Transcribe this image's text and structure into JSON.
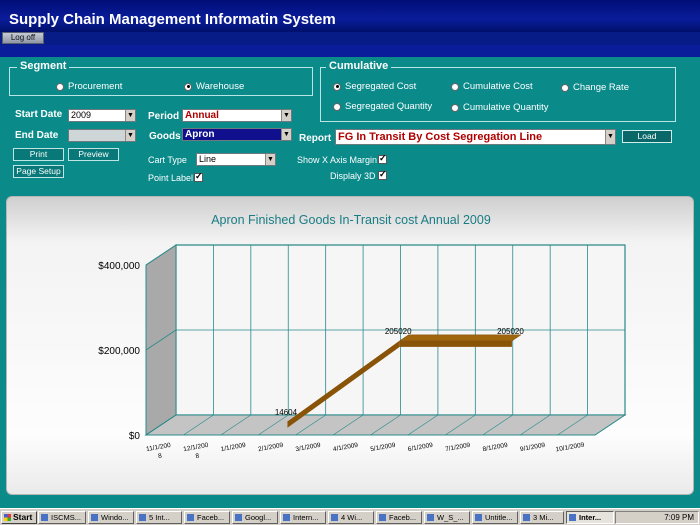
{
  "app": {
    "title": "Supply Chain Management Informatin System",
    "logoff": "Log off"
  },
  "segment": {
    "legend": "Segment",
    "options": [
      "Procurement",
      "Warehouse"
    ],
    "selected": 1
  },
  "cumulative": {
    "legend": "Cumulative",
    "options": [
      "Segregated Cost",
      "Cumulative Cost",
      "Change Rate",
      "Segregated Quantity",
      "Cumulative Quantity"
    ],
    "selected": 0
  },
  "form": {
    "start_date_label": "Start Date",
    "start_date": "2009",
    "end_date_label": "End Date",
    "end_date": "",
    "period_label": "Period",
    "period": "Annual",
    "goods_label": "Goods",
    "goods": "Apron",
    "report_label": "Report",
    "report": "FG In Transit By Cost Segregation Line",
    "load": "Load",
    "print": "Print",
    "preview": "Preview",
    "page_setup": "Page Setup",
    "cart_type_label": "Cart Type",
    "cart_type": "Line",
    "point_label": "Point Label",
    "show_x_margin": "Show X Axis Margin",
    "display_3d": "Displaly 3D"
  },
  "chart_data": {
    "type": "line",
    "title": "Apron Finished Goods In-Transit cost Annual 2009",
    "categories": [
      "11/1/2008",
      "12/1/2008",
      "1/1/2009",
      "2/1/2009",
      "3/1/2009",
      "4/1/2009",
      "5/1/2009",
      "6/1/2009",
      "7/1/2009",
      "8/1/2009",
      "9/1/2009",
      "10/1/2009"
    ],
    "category_labels": [
      "11/1/200\n8",
      "12/1/200\n8",
      "1/1/2009",
      "2/1/2009",
      "3/1/2009",
      "4/1/2009",
      "5/1/2009",
      "6/1/2009",
      "7/1/2009",
      "8/1/2009",
      "9/1/2009",
      "10/1/2009"
    ],
    "series": [
      {
        "values": [
          null,
          null,
          null,
          14604,
          null,
          null,
          205020,
          null,
          null,
          205020,
          null,
          null
        ]
      }
    ],
    "yticks": [
      "$0",
      "$200,000",
      "$400,000"
    ],
    "ylim": [
      0,
      400000
    ],
    "display_3d": true,
    "grid": true,
    "color": "#a0660e"
  },
  "taskbar": {
    "start": "Start",
    "items": [
      "ISCMS...",
      "Windo...",
      "5 Int...",
      "Faceb...",
      "Googl...",
      "Intern...",
      "4 Wi...",
      "Faceb...",
      "W_S_...",
      "Untitle...",
      "3 Mi...",
      "Inter..."
    ],
    "active": 11,
    "clock": "7:09 PM"
  }
}
